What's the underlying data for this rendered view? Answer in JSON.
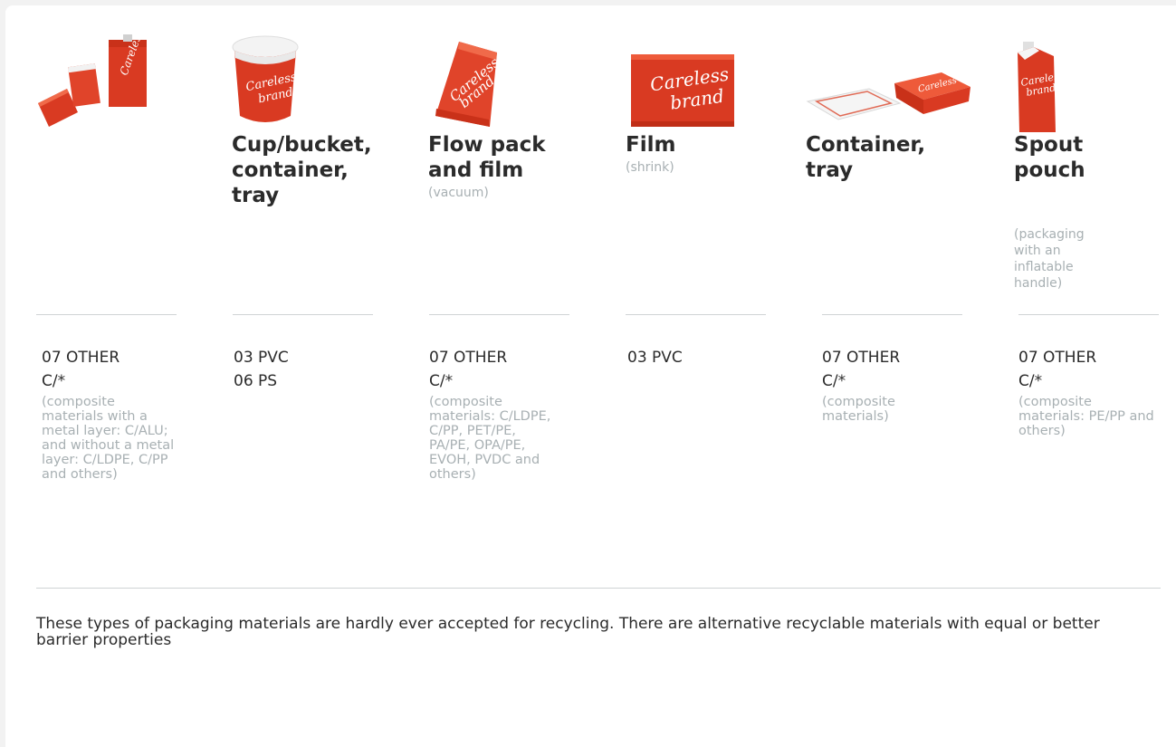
{
  "columns": [
    {
      "icon": "stand-up-pouches-icon",
      "title": "",
      "subtitle": "",
      "codes": [
        "07 OTHER",
        "C/*"
      ],
      "note": "(composite materials with a metal layer: C/ALU; and without a metal layer: C/LDPE, C/PP and others)"
    },
    {
      "icon": "bucket-icon",
      "title": "Cup/bucket, container, tray",
      "subtitle": "",
      "codes": [
        "03 PVC",
        "06 PS"
      ],
      "note": ""
    },
    {
      "icon": "flow-pack-icon",
      "title": "Flow pack and film",
      "subtitle": "(vacuum)",
      "codes": [
        "07 OTHER",
        "C/*"
      ],
      "note": "(composite materials: C/LDPE, C/PP, PET/PE, PA/PE, OPA/PE, EVOH, PVDC and others)"
    },
    {
      "icon": "film-pack-icon",
      "title": "Film",
      "subtitle": "(shrink)",
      "codes": [
        "03 PVC"
      ],
      "note": ""
    },
    {
      "icon": "container-tray-icon",
      "title": "Container, tray",
      "subtitle": "",
      "codes": [
        "07 OTHER",
        "C/*"
      ],
      "note": "(composite materials)"
    },
    {
      "icon": "spout-pouch-icon",
      "title": "Spout pouch",
      "subtitle": "(packaging with an inflatable handle)",
      "codes": [
        "07 OTHER",
        "C/*"
      ],
      "note": "(composite materials:  PE/PP and others)"
    }
  ],
  "brand": {
    "line1": "Careless",
    "line2": "brand"
  },
  "footer": "These types of packaging materials are hardly ever accepted for recycling. There are alternative recyclable materials with equal or better barrier properties",
  "colors": {
    "brand_red": "#d93a22",
    "brand_red_light": "#ee5a3a",
    "muted_text": "#a8b0b3",
    "divider": "#cfd3d5"
  }
}
